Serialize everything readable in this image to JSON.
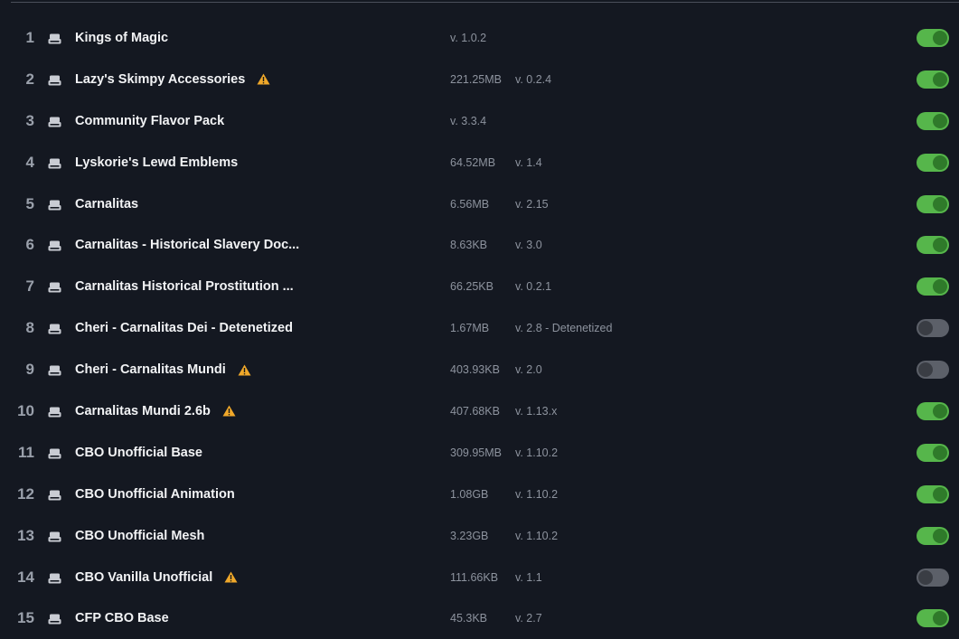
{
  "colors": {
    "background": "#141821",
    "toggle_on": "#56b64b",
    "toggle_off": "#5c6069",
    "warning": "#f0a82a"
  },
  "icons": {
    "drive": "drive-icon",
    "warning": "warning-icon"
  },
  "mods": [
    {
      "index": "1",
      "name": "Kings of Magic",
      "warning": false,
      "size": "",
      "version": "v. 1.0.2",
      "enabled": true
    },
    {
      "index": "2",
      "name": "Lazy's Skimpy Accessories",
      "warning": true,
      "size": "221.25MB",
      "version": "v. 0.2.4",
      "enabled": true
    },
    {
      "index": "3",
      "name": "Community Flavor Pack",
      "warning": false,
      "size": "",
      "version": "v. 3.3.4",
      "enabled": true
    },
    {
      "index": "4",
      "name": "Lyskorie's Lewd Emblems",
      "warning": false,
      "size": "64.52MB",
      "version": "v. 1.4",
      "enabled": true
    },
    {
      "index": "5",
      "name": "Carnalitas",
      "warning": false,
      "size": "6.56MB",
      "version": "v. 2.15",
      "enabled": true
    },
    {
      "index": "6",
      "name": "Carnalitas - Historical Slavery Doc...",
      "warning": false,
      "size": "8.63KB",
      "version": "v. 3.0",
      "enabled": true
    },
    {
      "index": "7",
      "name": "Carnalitas Historical Prostitution ...",
      "warning": false,
      "size": "66.25KB",
      "version": "v. 0.2.1",
      "enabled": true
    },
    {
      "index": "8",
      "name": "Cheri - Carnalitas Dei - Detenetized",
      "warning": false,
      "size": "1.67MB",
      "version": "v. 2.8 - Detenetized",
      "enabled": false
    },
    {
      "index": "9",
      "name": "Cheri - Carnalitas Mundi",
      "warning": true,
      "size": "403.93KB",
      "version": "v. 2.0",
      "enabled": false
    },
    {
      "index": "10",
      "name": "Carnalitas Mundi 2.6b",
      "warning": true,
      "size": "407.68KB",
      "version": "v. 1.13.x",
      "enabled": true
    },
    {
      "index": "11",
      "name": "CBO Unofficial Base",
      "warning": false,
      "size": "309.95MB",
      "version": "v. 1.10.2",
      "enabled": true
    },
    {
      "index": "12",
      "name": "CBO Unofficial Animation",
      "warning": false,
      "size": "1.08GB",
      "version": "v. 1.10.2",
      "enabled": true
    },
    {
      "index": "13",
      "name": "CBO Unofficial Mesh",
      "warning": false,
      "size": "3.23GB",
      "version": "v. 1.10.2",
      "enabled": true
    },
    {
      "index": "14",
      "name": "CBO Vanilla Unofficial",
      "warning": true,
      "size": "111.66KB",
      "version": "v. 1.1",
      "enabled": false
    },
    {
      "index": "15",
      "name": "CFP CBO Base",
      "warning": false,
      "size": "45.3KB",
      "version": "v. 2.7",
      "enabled": true
    }
  ]
}
